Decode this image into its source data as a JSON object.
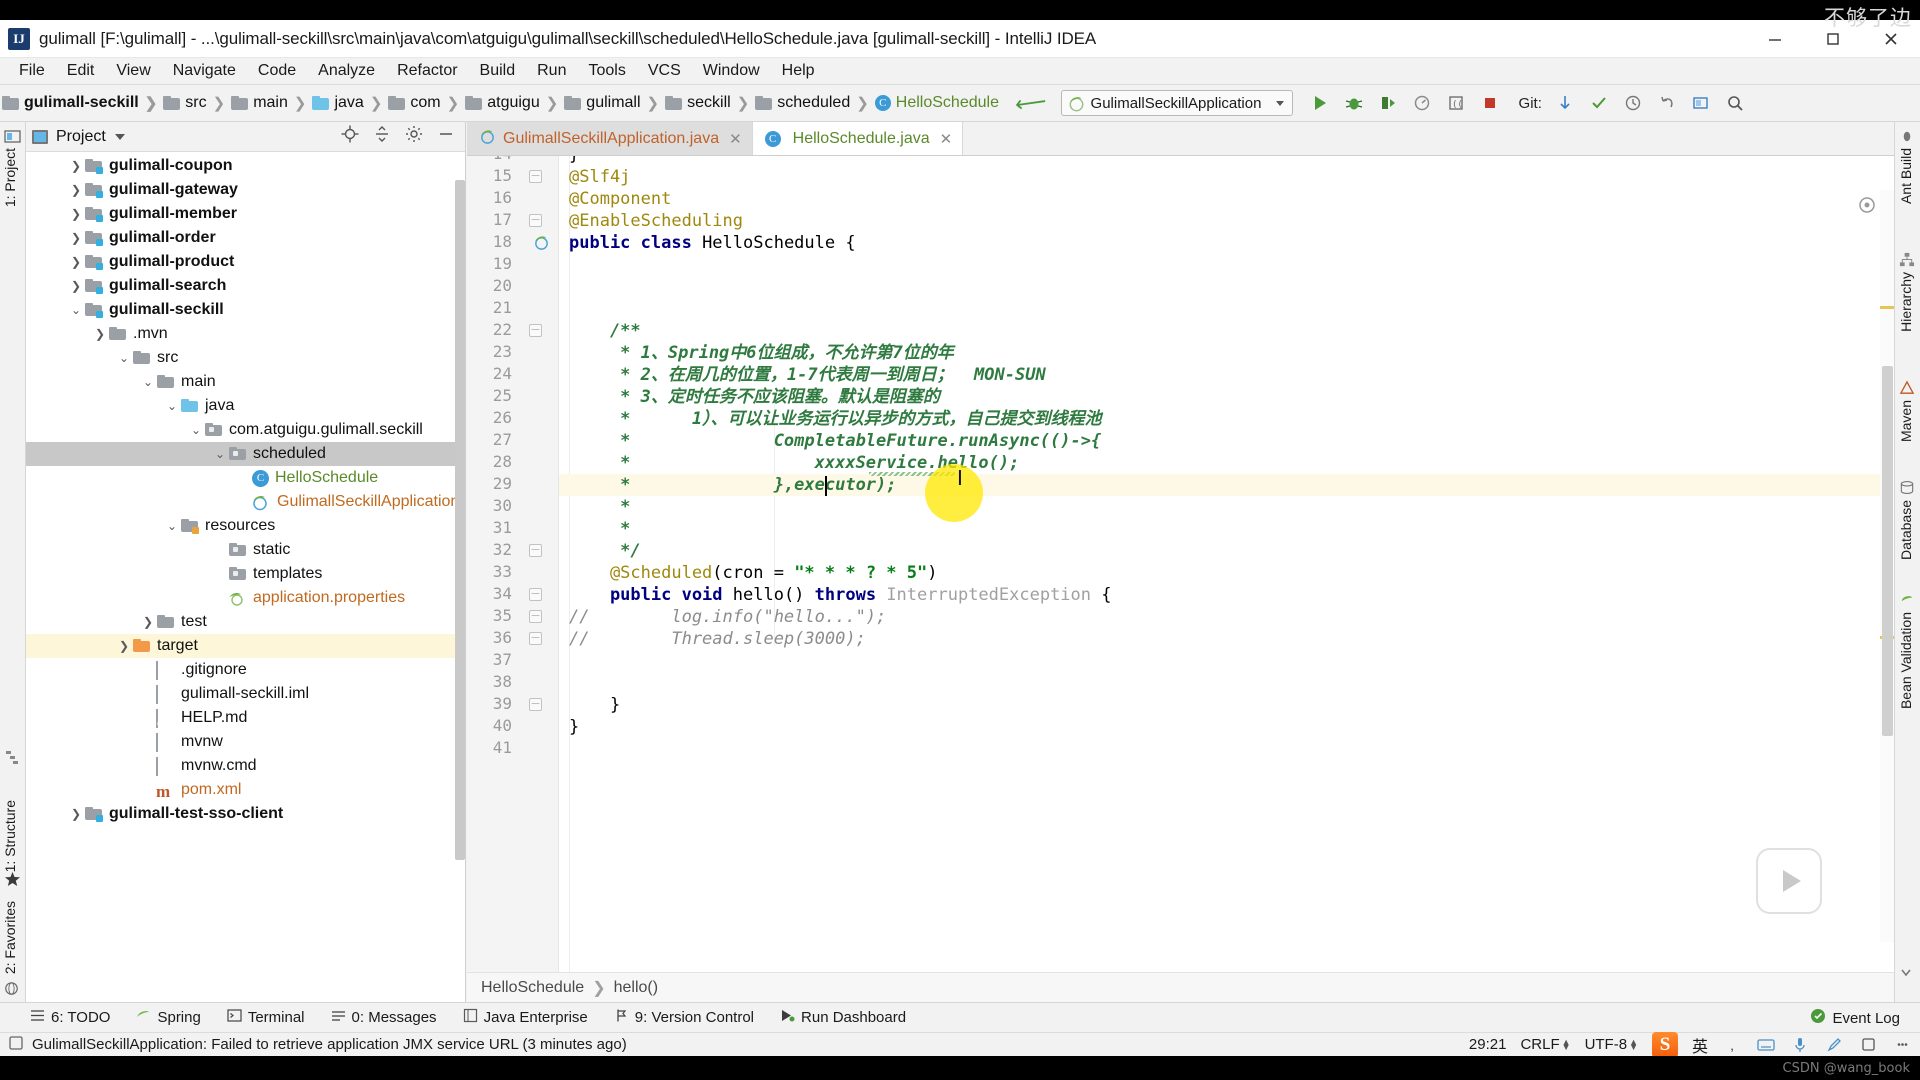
{
  "window": {
    "title": "gulimall [F:\\gulimall] - ...\\gulimall-seckill\\src\\main\\java\\com\\atguigu\\gulimall\\seckill\\scheduled\\HelloSchedule.java [gulimall-seckill] - IntelliJ IDEA",
    "app_icon": "intellij-idea-icon",
    "minimize_label": "–",
    "maximize_label": "❐",
    "close_label": "✕",
    "watermark": "不够了边"
  },
  "menubar": {
    "items": [
      {
        "label": "File",
        "mnemonic": "F"
      },
      {
        "label": "Edit",
        "mnemonic": "E"
      },
      {
        "label": "View",
        "mnemonic": "V"
      },
      {
        "label": "Navigate",
        "mnemonic": "N"
      },
      {
        "label": "Code",
        "mnemonic": "C"
      },
      {
        "label": "Analyze",
        "mnemonic": "z"
      },
      {
        "label": "Refactor",
        "mnemonic": "R"
      },
      {
        "label": "Build",
        "mnemonic": "B"
      },
      {
        "label": "Run",
        "mnemonic": "u"
      },
      {
        "label": "Tools",
        "mnemonic": "T"
      },
      {
        "label": "VCS",
        "mnemonic": "S"
      },
      {
        "label": "Window",
        "mnemonic": "W"
      },
      {
        "label": "Help",
        "mnemonic": "H"
      }
    ]
  },
  "navbar": {
    "crumbs": [
      {
        "label": "gulimall-seckill",
        "icon": "module-icon",
        "bold": true
      },
      {
        "label": "src",
        "icon": "folder-icon"
      },
      {
        "label": "main",
        "icon": "folder-icon"
      },
      {
        "label": "java",
        "icon": "folder-blue-icon"
      },
      {
        "label": "com",
        "icon": "package-icon"
      },
      {
        "label": "atguigu",
        "icon": "package-icon"
      },
      {
        "label": "gulimall",
        "icon": "package-icon"
      },
      {
        "label": "seckill",
        "icon": "package-icon"
      },
      {
        "label": "scheduled",
        "icon": "package-icon"
      },
      {
        "label": "HelloSchedule",
        "icon": "class-icon",
        "green": true
      }
    ],
    "run_config": "GulimallSeckillApplication",
    "run_config_icon": "spring-boot-icon",
    "git_label": "Git:",
    "toolbar_icons": [
      "back-arrow-icon",
      "run-icon",
      "debug-icon",
      "run-with-coverage-icon",
      "profile-icon",
      "stop-icon",
      "git-update-icon",
      "git-commit-icon",
      "history-icon",
      "undo-icon",
      "select-in-icon",
      "search-everywhere-icon"
    ]
  },
  "left_rail": {
    "top": [
      {
        "label": "1: Project",
        "icon": "project-icon"
      }
    ],
    "bottom": [
      {
        "label": "1: Structure",
        "icon": "structure-icon"
      },
      {
        "label": "2: Favorites",
        "icon": "star-icon"
      },
      {
        "label": "Web",
        "icon": "web-icon"
      }
    ]
  },
  "right_rail": {
    "items": [
      {
        "label": "Ant Build",
        "icon": "ant-icon"
      },
      {
        "label": "Hierarchy",
        "icon": "hierarchy-icon"
      },
      {
        "label": "Maven",
        "icon": "maven-icon"
      },
      {
        "label": "Database",
        "icon": "database-icon"
      },
      {
        "label": "Bean Validation",
        "icon": "bean-icon"
      }
    ]
  },
  "project_panel": {
    "title": "Project",
    "header_icons": [
      "locate-icon",
      "collapse-all-icon",
      "settings-icon",
      "hide-icon"
    ],
    "tree": [
      {
        "label": "gulimall-coupon",
        "depth": 1,
        "arrow": "collapsed",
        "icon": "module-folder",
        "bold": true
      },
      {
        "label": "gulimall-gateway",
        "depth": 1,
        "arrow": "collapsed",
        "icon": "module-folder",
        "bold": true
      },
      {
        "label": "gulimall-member",
        "depth": 1,
        "arrow": "collapsed",
        "icon": "module-folder",
        "bold": true
      },
      {
        "label": "gulimall-order",
        "depth": 1,
        "arrow": "collapsed",
        "icon": "module-folder",
        "bold": true
      },
      {
        "label": "gulimall-product",
        "depth": 1,
        "arrow": "collapsed",
        "icon": "module-folder",
        "bold": true
      },
      {
        "label": "gulimall-search",
        "depth": 1,
        "arrow": "collapsed",
        "icon": "module-folder",
        "bold": true
      },
      {
        "label": "gulimall-seckill",
        "depth": 1,
        "arrow": "expanded",
        "icon": "module-folder",
        "bold": true
      },
      {
        "label": ".mvn",
        "depth": 2,
        "arrow": "collapsed",
        "icon": "folder"
      },
      {
        "label": "src",
        "depth": 2,
        "arrow": "expanded",
        "icon": "folder"
      },
      {
        "label": "main",
        "depth": 3,
        "arrow": "expanded",
        "icon": "folder"
      },
      {
        "label": "java",
        "depth": 4,
        "arrow": "expanded",
        "icon": "folder-blue"
      },
      {
        "label": "com.atguigu.gulimall.seckill",
        "depth": 5,
        "arrow": "expanded",
        "icon": "package"
      },
      {
        "label": "scheduled",
        "depth": 6,
        "arrow": "expanded",
        "icon": "package",
        "state": "selected"
      },
      {
        "label": "HelloSchedule",
        "depth": 7,
        "arrow": "none",
        "icon": "class",
        "color": "green"
      },
      {
        "label": "GulimallSeckillApplication",
        "depth": 7,
        "arrow": "none",
        "icon": "spring-class",
        "color": "orange"
      },
      {
        "label": "resources",
        "depth": 4,
        "arrow": "expanded",
        "icon": "resources-folder"
      },
      {
        "label": "static",
        "depth": 5,
        "arrow": "none",
        "icon": "package"
      },
      {
        "label": "templates",
        "depth": 5,
        "arrow": "none",
        "icon": "package"
      },
      {
        "label": "application.properties",
        "depth": 5,
        "arrow": "none",
        "icon": "spring-properties",
        "color": "orange"
      },
      {
        "label": "test",
        "depth": 3,
        "arrow": "collapsed",
        "icon": "folder"
      },
      {
        "label": "target",
        "depth": 2,
        "arrow": "collapsed",
        "icon": "folder-orange",
        "state": "highlighted"
      },
      {
        "label": ".gitignore",
        "depth": 3,
        "arrow": "none",
        "icon": "file"
      },
      {
        "label": "gulimall-seckill.iml",
        "depth": 3,
        "arrow": "none",
        "icon": "iml-file"
      },
      {
        "label": "HELP.md",
        "depth": 3,
        "arrow": "none",
        "icon": "md-file"
      },
      {
        "label": "mvnw",
        "depth": 3,
        "arrow": "none",
        "icon": "file"
      },
      {
        "label": "mvnw.cmd",
        "depth": 3,
        "arrow": "none",
        "icon": "file"
      },
      {
        "label": "pom.xml",
        "depth": 3,
        "arrow": "none",
        "icon": "maven-file",
        "color": "orange"
      },
      {
        "label": "gulimall-test-sso-client",
        "depth": 1,
        "arrow": "collapsed",
        "icon": "module-folder",
        "bold": true
      }
    ]
  },
  "editor": {
    "tabs": [
      {
        "label": "GulimallSeckillApplication.java",
        "icon": "spring-class-icon",
        "active": false
      },
      {
        "label": "HelloSchedule.java",
        "icon": "class-icon",
        "active": true
      }
    ],
    "first_visible_line": 15,
    "lines": [
      {
        "n": 15,
        "text": "@Slf4j",
        "fold": "end-top"
      },
      {
        "n": 16,
        "text": "@Component"
      },
      {
        "n": 17,
        "text": "@EnableScheduling",
        "fold": "start"
      },
      {
        "n": 18,
        "text": "public class HelloSchedule {",
        "gutter_icon": "spring-bean-icon"
      },
      {
        "n": 19,
        "text": ""
      },
      {
        "n": 20,
        "text": ""
      },
      {
        "n": 21,
        "text": ""
      },
      {
        "n": 22,
        "text": "    /**",
        "fold": "start"
      },
      {
        "n": 23,
        "text": "     * 1、Spring中6位组成，不允许第7位的年"
      },
      {
        "n": 24,
        "text": "     * 2、在周几的位置，1-7代表周一到周日；  MON-SUN"
      },
      {
        "n": 25,
        "text": "     * 3、定时任务不应该阻塞。默认是阻塞的"
      },
      {
        "n": 26,
        "text": "     *      1）、可以让业务运行以异步的方式，自己提交到线程池"
      },
      {
        "n": 27,
        "text": "     *              CompletableFuture.runAsync(()->{"
      },
      {
        "n": 28,
        "text": "     *                  xxxxService.hello();"
      },
      {
        "n": 29,
        "text": "     *              },executor);",
        "highlighted": true
      },
      {
        "n": 30,
        "text": "     *"
      },
      {
        "n": 31,
        "text": "     *"
      },
      {
        "n": 32,
        "text": "     */",
        "fold": "end"
      },
      {
        "n": 33,
        "text": "    @Scheduled(cron = \"* * * ? * 5\")"
      },
      {
        "n": 34,
        "text": "    public void hello() throws InterruptedException {",
        "fold": "start"
      },
      {
        "n": 35,
        "text": "//        log.info(\"hello...\");",
        "fold": "start"
      },
      {
        "n": 36,
        "text": "//        Thread.sleep(3000);",
        "fold": "start"
      },
      {
        "n": 37,
        "text": ""
      },
      {
        "n": 38,
        "text": ""
      },
      {
        "n": 39,
        "text": "    }",
        "fold": "end"
      },
      {
        "n": 40,
        "text": "}"
      },
      {
        "n": 41,
        "text": ""
      }
    ],
    "breadcrumb": [
      "HelloSchedule",
      "hello()"
    ],
    "cursor_overlay": "text-cursor-icon"
  },
  "bottom_toolwindows": [
    {
      "label": "6: TODO",
      "mnemonic": "6",
      "icon": "todo-icon"
    },
    {
      "label": "Spring",
      "icon": "spring-icon"
    },
    {
      "label": "Terminal",
      "icon": "terminal-icon"
    },
    {
      "label": "0: Messages",
      "mnemonic": "0",
      "icon": "messages-icon"
    },
    {
      "label": "Java Enterprise",
      "icon": "java-ee-icon"
    },
    {
      "label": "9: Version Control",
      "mnemonic": "9",
      "icon": "vcs-icon"
    },
    {
      "label": "Run Dashboard",
      "icon": "run-dashboard-icon"
    }
  ],
  "statusbar": {
    "message": "GulimallSeckillApplication: Failed to retrieve application JMX service URL (3 minutes ago)",
    "message_icon": "notification-icon",
    "caret_position": "29:21",
    "line_separator": "CRLF",
    "encoding": "UTF-8",
    "event_log": "Event Log",
    "event_log_icon": "event-log-icon",
    "ime": "英",
    "ime_icons": [
      "sogou-icon",
      "keyboard-icon",
      "mic-icon",
      "pen-icon",
      "box-icon",
      "menu-icon"
    ]
  },
  "watermark_bottom": "CSDN @wang_book",
  "colors": {
    "accent_green": "#4a9a3c",
    "keyword_blue": "#000080",
    "comment_green": "#2f7a3f",
    "annotation_gold": "#9e880d",
    "string_green": "#067d17",
    "highlight_yellow": "#ffe800",
    "selection_gray": "#c8c8c8",
    "row_highlight": "#fdf9e6",
    "orange": "#c06a20"
  }
}
